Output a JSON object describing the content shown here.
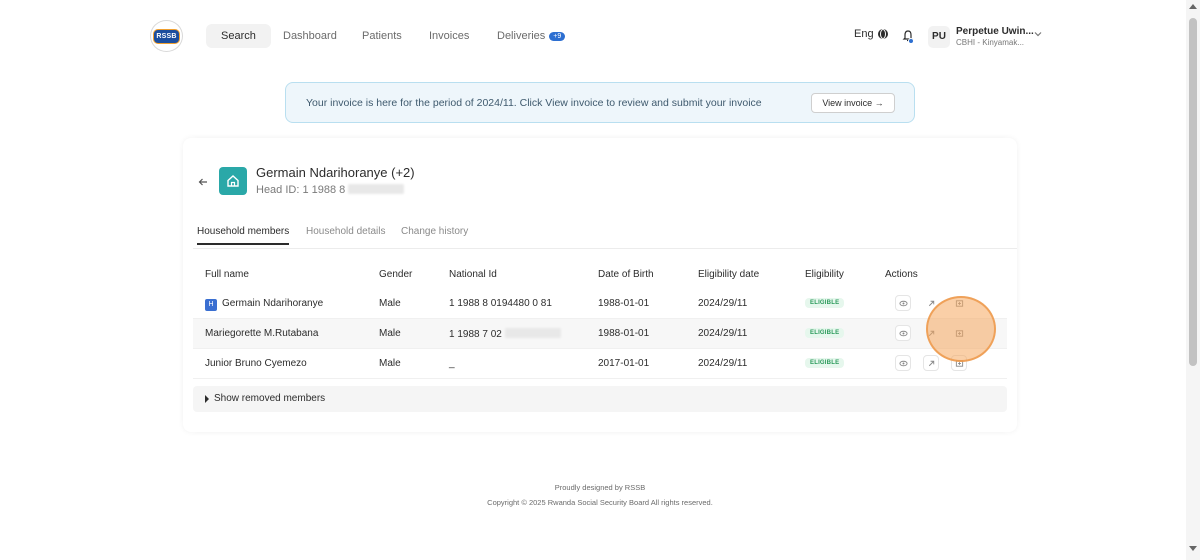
{
  "nav": {
    "logo_text": "RSSB",
    "items": [
      {
        "label": "Search"
      },
      {
        "label": "Dashboard"
      },
      {
        "label": "Patients"
      },
      {
        "label": "Invoices"
      },
      {
        "label": "Deliveries",
        "badge": "+9"
      }
    ],
    "lang": "Eng",
    "user": {
      "initials": "PU",
      "name": "Perpetue Uwin...",
      "sub": "CBHI - Kinyamak..."
    }
  },
  "banner": {
    "text": "Your invoice is here for the period of 2024/11. Click View invoice to review and submit your invoice",
    "button": "View invoice  →"
  },
  "household": {
    "title": "Germain Ndarihoranye (+2)",
    "head_id_prefix": "Head ID: 1 1988 8",
    "tabs": [
      {
        "label": "Household members"
      },
      {
        "label": "Household details"
      },
      {
        "label": "Change history"
      }
    ],
    "columns": {
      "full_name": "Full name",
      "gender": "Gender",
      "national_id": "National Id",
      "dob": "Date of Birth",
      "elig_date": "Eligibility date",
      "eligibility": "Eligibility",
      "actions": "Actions"
    },
    "members": [
      {
        "badge": "H",
        "name": "Germain Ndarihoranye",
        "gender": "Male",
        "national_id": "1 1988 8 0194480 0 81",
        "dob": "1988-01-01",
        "elig_date": "2024/29/11",
        "eligibility": "ELIGIBLE"
      },
      {
        "name": "Mariegorette M.Rutabana",
        "gender": "Male",
        "national_id": "1 1988 7 02",
        "dob": "1988-01-01",
        "elig_date": "2024/29/11",
        "eligibility": "ELIGIBLE"
      },
      {
        "name": "Junior Bruno Cyemezo",
        "gender": "Male",
        "national_id": "_",
        "dob": "2017-01-01",
        "elig_date": "2024/29/11",
        "eligibility": "ELIGIBLE"
      }
    ],
    "removed_label": "Show removed members"
  },
  "footer": {
    "line1": "Proudly designed by RSSB",
    "line2": "Copyright © 2025 Rwanda Social Security Board All rights reserved."
  },
  "colors": {
    "accent": "#2d6fd1",
    "teal": "#2aa8a8",
    "eligible_bg": "#e6f7ed",
    "eligible_text": "#2a9a5a"
  }
}
